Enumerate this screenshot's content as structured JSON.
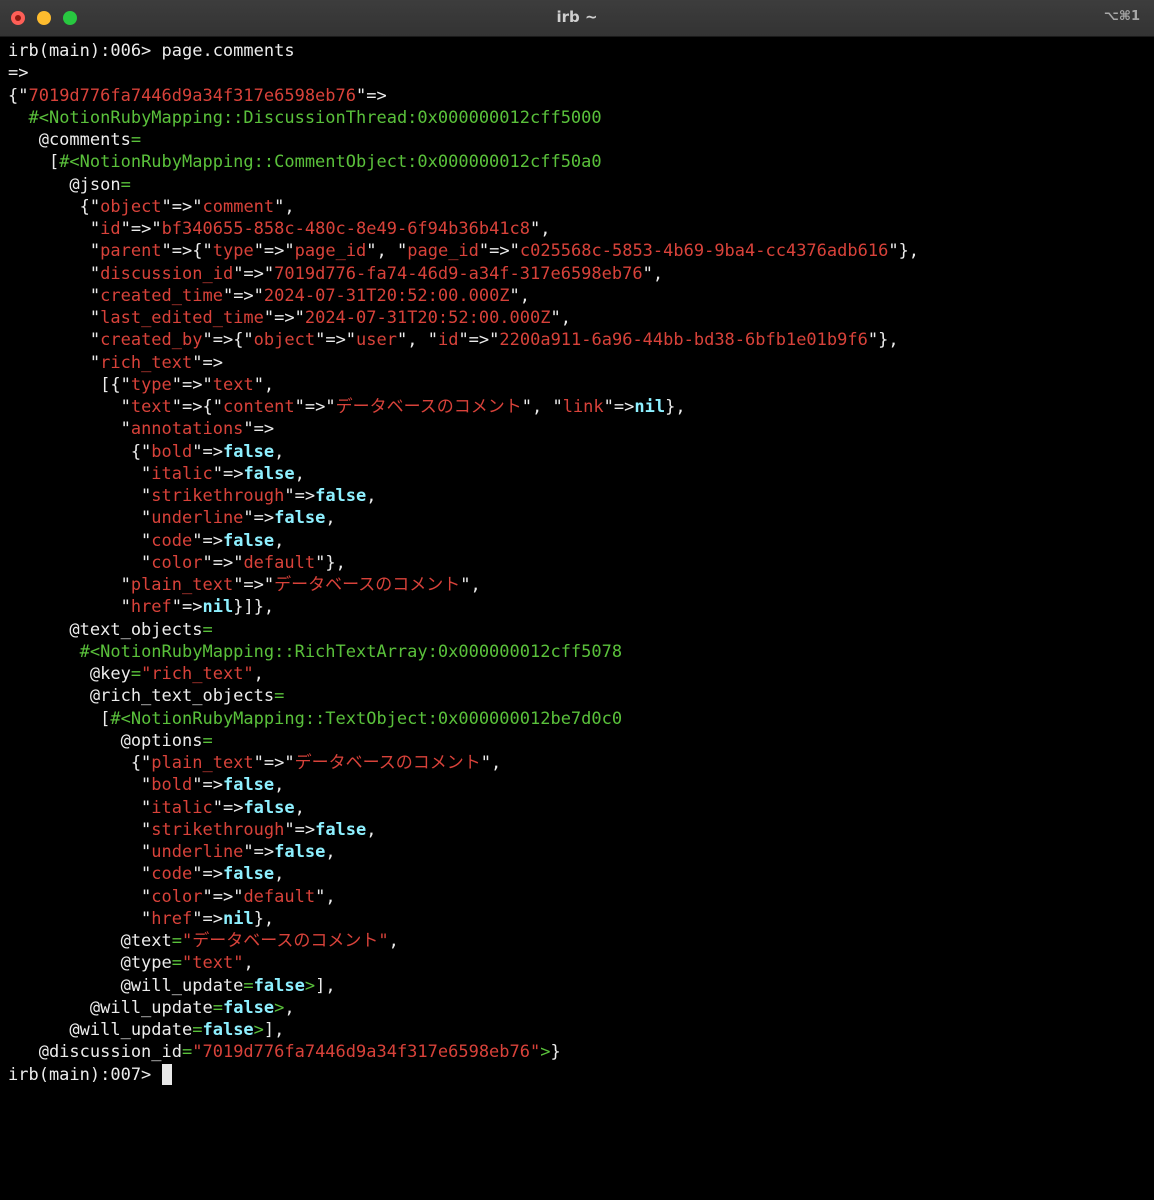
{
  "window": {
    "title": "irb ~",
    "shortcut": "⌥⌘1"
  },
  "terminal": {
    "lines": [
      [
        [
          "w",
          "irb(main):006> page.comments"
        ]
      ],
      [
        [
          "w",
          "=>"
        ]
      ],
      [
        [
          "w",
          "{\""
        ],
        [
          "r",
          "7019d776fa7446d9a34f317e6598eb76"
        ],
        [
          "w",
          "\"=>"
        ]
      ],
      [
        [
          "w",
          "  "
        ],
        [
          "g",
          "#<NotionRubyMapping::DiscussionThread:0x000000012cff5000"
        ]
      ],
      [
        [
          "w",
          "   @comments"
        ],
        [
          "g",
          "="
        ]
      ],
      [
        [
          "w",
          "    ["
        ],
        [
          "g",
          "#<NotionRubyMapping::CommentObject:0x000000012cff50a0"
        ]
      ],
      [
        [
          "w",
          "      @json"
        ],
        [
          "g",
          "="
        ]
      ],
      [
        [
          "w",
          "       {\""
        ],
        [
          "r",
          "object"
        ],
        [
          "w",
          "\"=>\""
        ],
        [
          "r",
          "comment"
        ],
        [
          "w",
          "\","
        ]
      ],
      [
        [
          "w",
          "        \""
        ],
        [
          "r",
          "id"
        ],
        [
          "w",
          "\"=>\""
        ],
        [
          "r",
          "bf340655-858c-480c-8e49-6f94b36b41c8"
        ],
        [
          "w",
          "\","
        ]
      ],
      [
        [
          "w",
          "        \""
        ],
        [
          "r",
          "parent"
        ],
        [
          "w",
          "\"=>{\""
        ],
        [
          "r",
          "type"
        ],
        [
          "w",
          "\"=>\""
        ],
        [
          "r",
          "page_id"
        ],
        [
          "w",
          "\", \""
        ],
        [
          "r",
          "page_id"
        ],
        [
          "w",
          "\"=>\""
        ],
        [
          "r",
          "c025568c-5853-4b69-9ba4-cc4376adb616"
        ],
        [
          "w",
          "\"},"
        ]
      ],
      [
        [
          "w",
          "        \""
        ],
        [
          "r",
          "discussion_id"
        ],
        [
          "w",
          "\"=>\""
        ],
        [
          "r",
          "7019d776-fa74-46d9-a34f-317e6598eb76"
        ],
        [
          "w",
          "\","
        ]
      ],
      [
        [
          "w",
          "        \""
        ],
        [
          "r",
          "created_time"
        ],
        [
          "w",
          "\"=>\""
        ],
        [
          "r",
          "2024-07-31T20:52:00.000Z"
        ],
        [
          "w",
          "\","
        ]
      ],
      [
        [
          "w",
          "        \""
        ],
        [
          "r",
          "last_edited_time"
        ],
        [
          "w",
          "\"=>\""
        ],
        [
          "r",
          "2024-07-31T20:52:00.000Z"
        ],
        [
          "w",
          "\","
        ]
      ],
      [
        [
          "w",
          "        \""
        ],
        [
          "r",
          "created_by"
        ],
        [
          "w",
          "\"=>{\""
        ],
        [
          "r",
          "object"
        ],
        [
          "w",
          "\"=>\""
        ],
        [
          "r",
          "user"
        ],
        [
          "w",
          "\", \""
        ],
        [
          "r",
          "id"
        ],
        [
          "w",
          "\"=>\""
        ],
        [
          "r",
          "2200a911-6a96-44bb-bd38-6bfb1e01b9f6"
        ],
        [
          "w",
          "\"},"
        ]
      ],
      [
        [
          "w",
          "        \""
        ],
        [
          "r",
          "rich_text"
        ],
        [
          "w",
          "\"=>"
        ]
      ],
      [
        [
          "w",
          "         [{\""
        ],
        [
          "r",
          "type"
        ],
        [
          "w",
          "\"=>\""
        ],
        [
          "r",
          "text"
        ],
        [
          "w",
          "\","
        ]
      ],
      [
        [
          "w",
          "           \""
        ],
        [
          "r",
          "text"
        ],
        [
          "w",
          "\"=>{\""
        ],
        [
          "r",
          "content"
        ],
        [
          "w",
          "\"=>\""
        ],
        [
          "r",
          "データベースのコメント"
        ],
        [
          "w",
          "\", \""
        ],
        [
          "r",
          "link"
        ],
        [
          "w",
          "\"=>"
        ],
        [
          "b",
          "nil"
        ],
        [
          "w",
          "},"
        ]
      ],
      [
        [
          "w",
          "           \""
        ],
        [
          "r",
          "annotations"
        ],
        [
          "w",
          "\"=>"
        ]
      ],
      [
        [
          "w",
          "            {\""
        ],
        [
          "r",
          "bold"
        ],
        [
          "w",
          "\"=>"
        ],
        [
          "b",
          "false"
        ],
        [
          "w",
          ","
        ]
      ],
      [
        [
          "w",
          "             \""
        ],
        [
          "r",
          "italic"
        ],
        [
          "w",
          "\"=>"
        ],
        [
          "b",
          "false"
        ],
        [
          "w",
          ","
        ]
      ],
      [
        [
          "w",
          "             \""
        ],
        [
          "r",
          "strikethrough"
        ],
        [
          "w",
          "\"=>"
        ],
        [
          "b",
          "false"
        ],
        [
          "w",
          ","
        ]
      ],
      [
        [
          "w",
          "             \""
        ],
        [
          "r",
          "underline"
        ],
        [
          "w",
          "\"=>"
        ],
        [
          "b",
          "false"
        ],
        [
          "w",
          ","
        ]
      ],
      [
        [
          "w",
          "             \""
        ],
        [
          "r",
          "code"
        ],
        [
          "w",
          "\"=>"
        ],
        [
          "b",
          "false"
        ],
        [
          "w",
          ","
        ]
      ],
      [
        [
          "w",
          "             \""
        ],
        [
          "r",
          "color"
        ],
        [
          "w",
          "\"=>\""
        ],
        [
          "r",
          "default"
        ],
        [
          "w",
          "\"},"
        ]
      ],
      [
        [
          "w",
          "           \""
        ],
        [
          "r",
          "plain_text"
        ],
        [
          "w",
          "\"=>\""
        ],
        [
          "r",
          "データベースのコメント"
        ],
        [
          "w",
          "\","
        ]
      ],
      [
        [
          "w",
          "           \""
        ],
        [
          "r",
          "href"
        ],
        [
          "w",
          "\"=>"
        ],
        [
          "b",
          "nil"
        ],
        [
          "w",
          "}]},"
        ]
      ],
      [
        [
          "w",
          "      @text_objects"
        ],
        [
          "g",
          "="
        ]
      ],
      [
        [
          "w",
          "       "
        ],
        [
          "g",
          "#<NotionRubyMapping::RichTextArray:0x000000012cff5078"
        ]
      ],
      [
        [
          "w",
          "        @key"
        ],
        [
          "g",
          "="
        ],
        [
          "r",
          "\"rich_text\""
        ],
        [
          "w",
          ","
        ]
      ],
      [
        [
          "w",
          "        @rich_text_objects"
        ],
        [
          "g",
          "="
        ]
      ],
      [
        [
          "w",
          "         ["
        ],
        [
          "g",
          "#<NotionRubyMapping::TextObject:0x000000012be7d0c0"
        ]
      ],
      [
        [
          "w",
          "           @options"
        ],
        [
          "g",
          "="
        ]
      ],
      [
        [
          "w",
          "            {\""
        ],
        [
          "r",
          "plain_text"
        ],
        [
          "w",
          "\"=>\""
        ],
        [
          "r",
          "データベースのコメント"
        ],
        [
          "w",
          "\","
        ]
      ],
      [
        [
          "w",
          "             \""
        ],
        [
          "r",
          "bold"
        ],
        [
          "w",
          "\"=>"
        ],
        [
          "b",
          "false"
        ],
        [
          "w",
          ","
        ]
      ],
      [
        [
          "w",
          "             \""
        ],
        [
          "r",
          "italic"
        ],
        [
          "w",
          "\"=>"
        ],
        [
          "b",
          "false"
        ],
        [
          "w",
          ","
        ]
      ],
      [
        [
          "w",
          "             \""
        ],
        [
          "r",
          "strikethrough"
        ],
        [
          "w",
          "\"=>"
        ],
        [
          "b",
          "false"
        ],
        [
          "w",
          ","
        ]
      ],
      [
        [
          "w",
          "             \""
        ],
        [
          "r",
          "underline"
        ],
        [
          "w",
          "\"=>"
        ],
        [
          "b",
          "false"
        ],
        [
          "w",
          ","
        ]
      ],
      [
        [
          "w",
          "             \""
        ],
        [
          "r",
          "code"
        ],
        [
          "w",
          "\"=>"
        ],
        [
          "b",
          "false"
        ],
        [
          "w",
          ","
        ]
      ],
      [
        [
          "w",
          "             \""
        ],
        [
          "r",
          "color"
        ],
        [
          "w",
          "\"=>\""
        ],
        [
          "r",
          "default"
        ],
        [
          "w",
          "\","
        ]
      ],
      [
        [
          "w",
          "             \""
        ],
        [
          "r",
          "href"
        ],
        [
          "w",
          "\"=>"
        ],
        [
          "b",
          "nil"
        ],
        [
          "w",
          "},"
        ]
      ],
      [
        [
          "w",
          "           @text"
        ],
        [
          "g",
          "="
        ],
        [
          "r",
          "\"データベースのコメント\""
        ],
        [
          "w",
          ","
        ]
      ],
      [
        [
          "w",
          "           @type"
        ],
        [
          "g",
          "="
        ],
        [
          "r",
          "\"text\""
        ],
        [
          "w",
          ","
        ]
      ],
      [
        [
          "w",
          "           @will_update"
        ],
        [
          "g",
          "="
        ],
        [
          "b",
          "false"
        ],
        [
          "g",
          ">"
        ],
        [
          "w",
          "],"
        ]
      ],
      [
        [
          "w",
          "        @will_update"
        ],
        [
          "g",
          "="
        ],
        [
          "b",
          "false"
        ],
        [
          "g",
          ">"
        ],
        [
          "w",
          ","
        ]
      ],
      [
        [
          "w",
          "      @will_update"
        ],
        [
          "g",
          "="
        ],
        [
          "b",
          "false"
        ],
        [
          "g",
          ">"
        ],
        [
          "w",
          "],"
        ]
      ],
      [
        [
          "w",
          "   @discussion_id"
        ],
        [
          "g",
          "="
        ],
        [
          "r",
          "\"7019d776fa7446d9a34f317e6598eb76\""
        ],
        [
          "g",
          ">"
        ],
        [
          "w",
          "}"
        ]
      ]
    ],
    "prompt": "irb(main):007> "
  }
}
